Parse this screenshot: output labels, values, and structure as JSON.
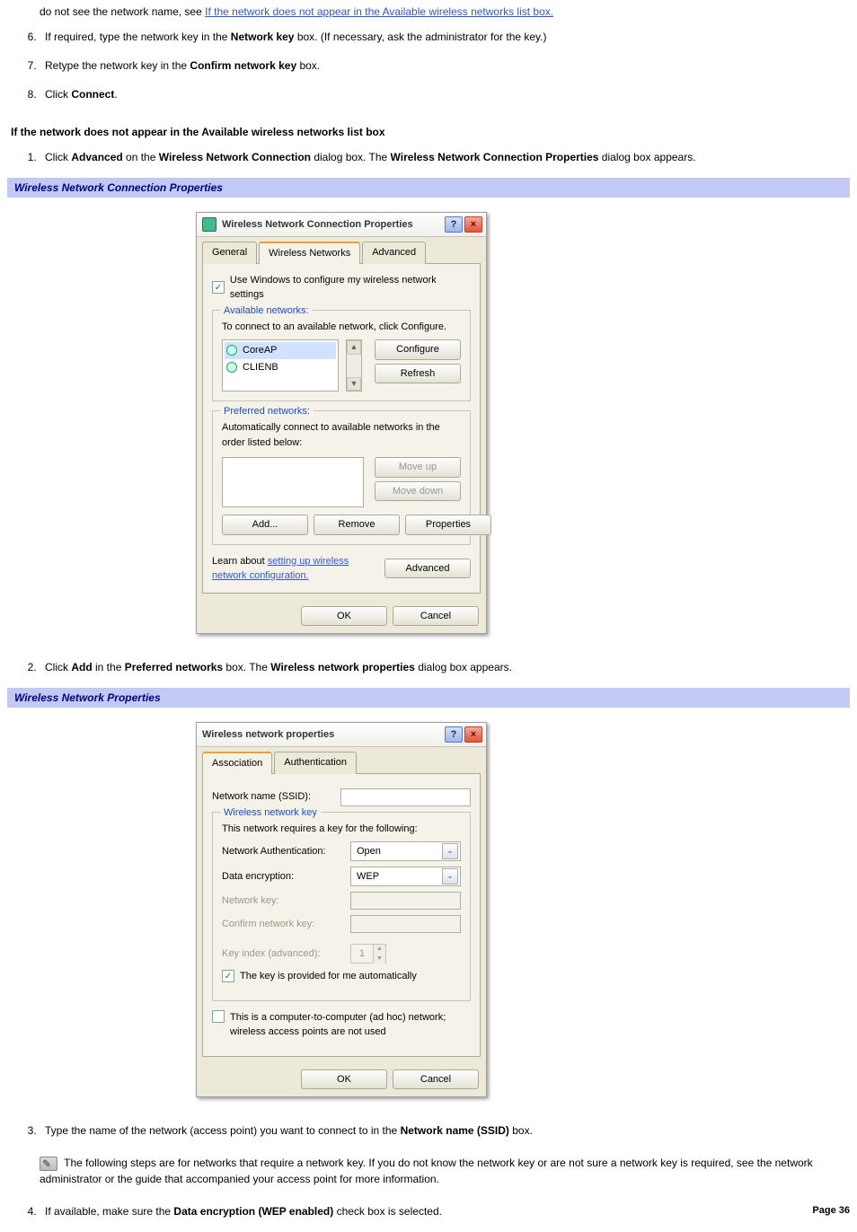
{
  "intro": {
    "fragment_prefix": "do not see the network name, see ",
    "link": "If the network does not appear in the Available wireless networks list box."
  },
  "list1": {
    "item6_a": "If required, type the network key in the ",
    "item6_b": "Network key",
    "item6_c": " box. (If necessary, ask the administrator for the key.)",
    "item7_a": "Retype the network key in the ",
    "item7_b": "Confirm network key",
    "item7_c": " box.",
    "item8_a": "Click ",
    "item8_b": "Connect",
    "item8_c": "."
  },
  "heading1": "If the network does not appear in the Available wireless networks list box",
  "list2": {
    "item1_a": "Click ",
    "item1_b": "Advanced",
    "item1_c": " on the ",
    "item1_d": "Wireless Network Connection",
    "item1_e": " dialog box. The ",
    "item1_f": "Wireless Network Connection Properties",
    "item1_g": " dialog box appears."
  },
  "caption1": "Wireless Network Connection Properties",
  "dlgA": {
    "title": "Wireless Network Connection Properties",
    "help": "?",
    "close": "×",
    "tabs": {
      "general": "General",
      "wireless": "Wireless Networks",
      "advanced": "Advanced"
    },
    "chk_label": "Use Windows to configure my wireless network settings",
    "avail_legend": "Available networks:",
    "avail_text": "To connect to an available network, click Configure.",
    "items": {
      "a": "CoreAP",
      "b": "CLIENB"
    },
    "scroll_up": "▲",
    "scroll_dn": "▼",
    "configure": "Configure",
    "refresh": "Refresh",
    "pref_legend": "Preferred networks:",
    "pref_text": "Automatically connect to available networks in the order listed below:",
    "moveup": "Move up",
    "movedown": "Move down",
    "add": "Add...",
    "remove": "Remove",
    "properties": "Properties",
    "learn_a": "Learn about ",
    "learn_b": "setting up wireless network configuration.",
    "advanced_btn": "Advanced",
    "ok": "OK",
    "cancel": "Cancel"
  },
  "list3": {
    "item2_a": "Click ",
    "item2_b": "Add",
    "item2_c": " in the ",
    "item2_d": "Preferred networks",
    "item2_e": " box. The ",
    "item2_f": "Wireless network properties",
    "item2_g": " dialog box appears."
  },
  "caption2": "Wireless Network Properties",
  "dlgB": {
    "title": "Wireless network properties",
    "help": "?",
    "close": "×",
    "tabs": {
      "assoc": "Association",
      "auth": "Authentication"
    },
    "ssid_label": "Network name (SSID):",
    "grp_legend": "Wireless network key",
    "grp_text": "This network requires a key for the following:",
    "auth_label": "Network Authentication:",
    "auth_val": "Open",
    "enc_label": "Data encryption:",
    "enc_val": "WEP",
    "key_label": "Network key:",
    "confirm_label": "Confirm network key:",
    "idx_label": "Key index (advanced):",
    "idx_val": "1",
    "auto_chk": "The key is provided for me automatically",
    "adhoc_chk": "This is a computer-to-computer (ad hoc) network; wireless access points are not used",
    "ok": "OK",
    "cancel": "Cancel",
    "dd": "⌄"
  },
  "list4": {
    "item3_a": "Type the name of the network (access point) you want to connect to in the ",
    "item3_b": "Network name (SSID)",
    "item3_c": " box.",
    "note": "The following steps are for networks that require a network key. If you do not know the network key or are not sure a network key is required, see the network administrator or the guide that accompanied your access point for more information.",
    "item4_a": "If available, make sure the ",
    "item4_b": "Data encryption (WEP enabled)",
    "item4_c": " check box is selected."
  },
  "page_num": "Page 36"
}
